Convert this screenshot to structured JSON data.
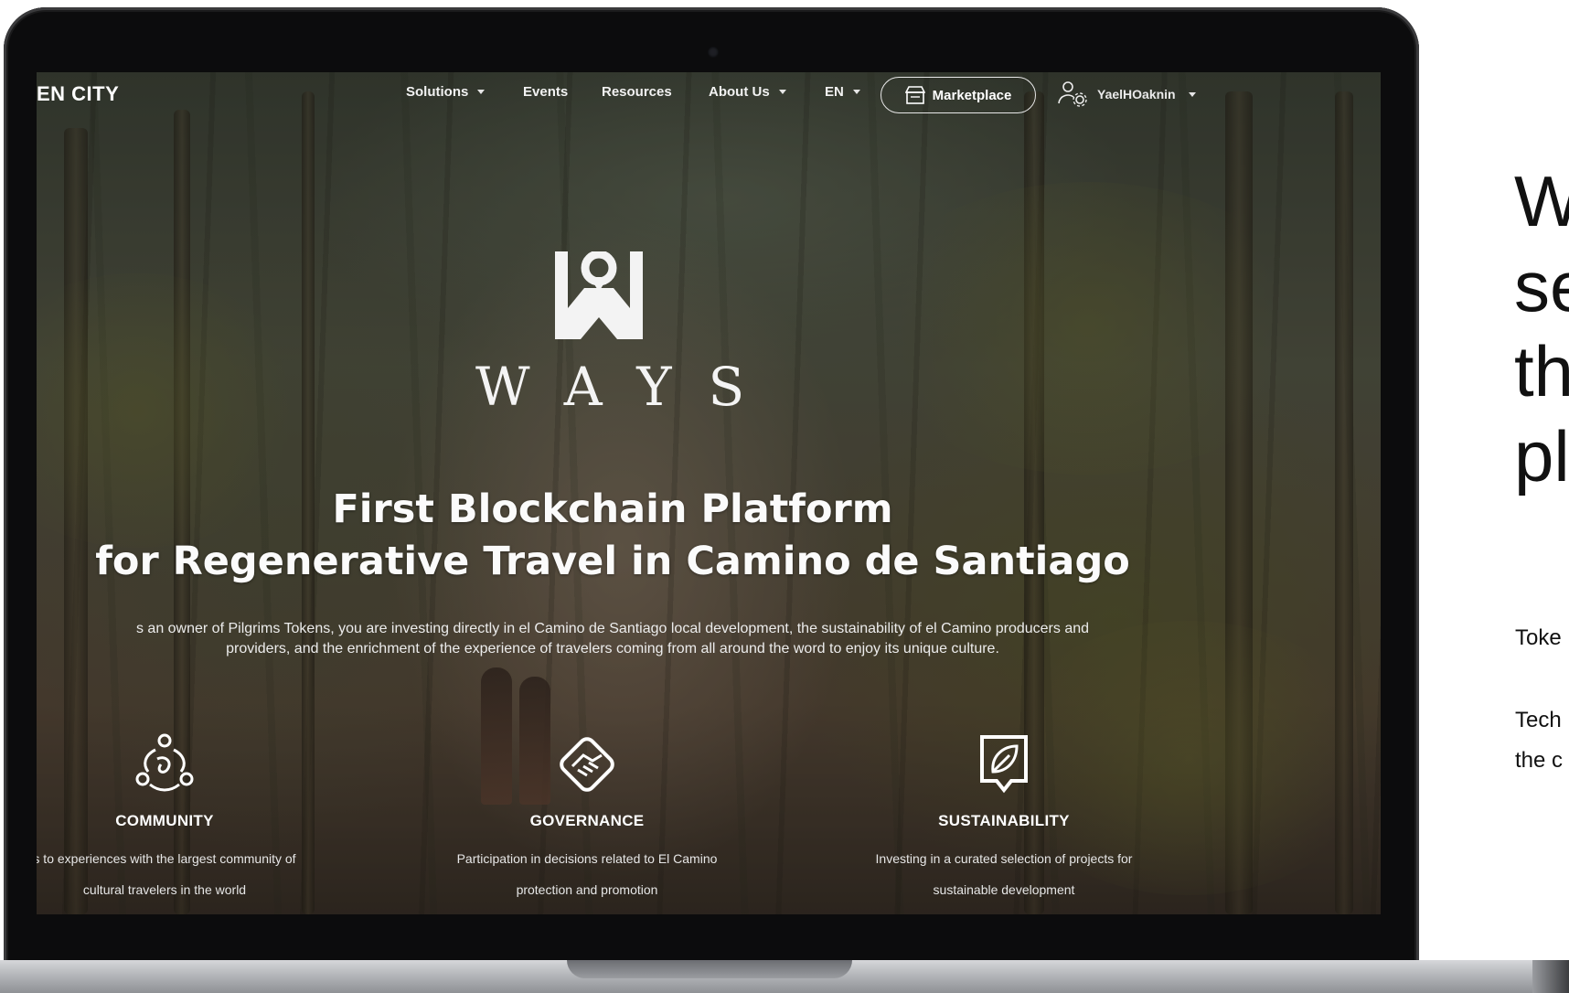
{
  "nav": {
    "brand": "EN CITY",
    "solutions": "Solutions",
    "events": "Events",
    "resources": "Resources",
    "about": "About Us",
    "language": "EN",
    "marketplace": "Marketplace",
    "user": "YaelHOaknin"
  },
  "hero": {
    "logo_text": "WAYS",
    "headline_line1": "First Blockchain Platform",
    "headline_line2": "for Regenerative Travel in Camino de Santiago",
    "sub_line1": "s an owner of Pilgrims Tokens, you are investing directly in el Camino de Santiago local development, the sustainability of el Camino producers and",
    "sub_line2": "providers, and the enrichment of the experience of travelers coming from all around the word to enjoy its unique culture."
  },
  "features": [
    {
      "icon": "community-icon",
      "title": "COMMUNITY",
      "desc1": "s to experiences with the largest community of",
      "desc2": "cultural travelers in the world"
    },
    {
      "icon": "handshake-icon",
      "title": "GOVERNANCE",
      "desc1": "Participation in decisions related to El Camino",
      "desc2": "protection and promotion"
    },
    {
      "icon": "leaf-icon",
      "title": "SUSTAINABILITY",
      "desc1": "Investing in a curated selection of projects for",
      "desc2": "sustainable development"
    }
  ],
  "side": {
    "heading": [
      "W",
      "se",
      "th",
      "pl"
    ],
    "para1": "Toke",
    "para2_line1": "Tech",
    "para2_line2": "the c"
  },
  "colors": {
    "text_on_photo": "#ffffff",
    "laptop_bezel": "#0c0c0d",
    "page_bg": "#ffffff",
    "side_text": "#111111"
  }
}
